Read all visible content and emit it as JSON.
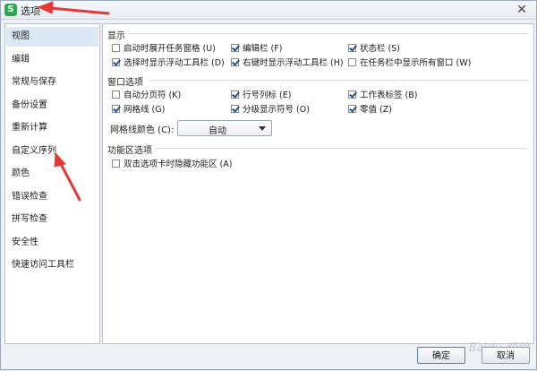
{
  "window": {
    "title": "选项",
    "app_icon_letter": "S",
    "close_label": "✕"
  },
  "sidebar": {
    "items": [
      {
        "label": "视图"
      },
      {
        "label": "编辑"
      },
      {
        "label": "常规与保存"
      },
      {
        "label": "备份设置"
      },
      {
        "label": "重新计算"
      },
      {
        "label": "自定义序列"
      },
      {
        "label": "颜色"
      },
      {
        "label": "错误检查"
      },
      {
        "label": "拼写检查"
      },
      {
        "label": "安全性"
      },
      {
        "label": "快速访问工具栏"
      }
    ]
  },
  "display": {
    "title": "显示",
    "options": [
      {
        "label": "启动时展开任务窗格 (U)",
        "checked": false
      },
      {
        "label": "编辑栏 (F)",
        "checked": true
      },
      {
        "label": "状态栏 (S)",
        "checked": true
      },
      {
        "label": "选择时显示浮动工具栏 (D)",
        "checked": true
      },
      {
        "label": "右键时显示浮动工具栏 (H)",
        "checked": true
      },
      {
        "label": "在任务栏中显示所有窗口 (W)",
        "checked": false
      }
    ]
  },
  "window_options": {
    "title": "窗口选项",
    "options": [
      {
        "label": "自动分页符 (K)",
        "checked": false
      },
      {
        "label": "行号列标 (E)",
        "checked": true
      },
      {
        "label": "工作表标签 (B)",
        "checked": true
      },
      {
        "label": "网格线 (G)",
        "checked": true
      },
      {
        "label": "分级显示符号 (O)",
        "checked": true
      },
      {
        "label": "零值 (Z)",
        "checked": true
      }
    ],
    "gridline_color_label": "网格线颜色 (C):",
    "gridline_color_value": "自动"
  },
  "ribbon": {
    "title": "功能区选项",
    "options": [
      {
        "label": "双击选项卡时隐藏功能区 (A)",
        "checked": false
      }
    ]
  },
  "buttons": {
    "ok": "确定",
    "cancel": "取消"
  },
  "watermark": "Baidu 经验",
  "colors": {
    "annotation_arrow": "#e53935",
    "selected_item_bg": "#dde8f6"
  }
}
